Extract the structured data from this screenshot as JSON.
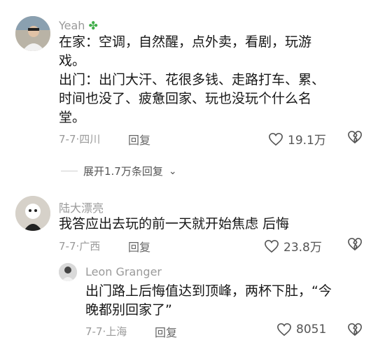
{
  "comments": [
    {
      "username": "Yeah",
      "badge": "four-leaf-clover",
      "content": "在家：空调，自然醒，点外卖，看剧，玩游戏。\n出门：出门大汗、花很多钱、走路打车、累、时间也没了、疲惫回家、玩也没玩个什么名堂。",
      "line1": "在家：空调，自然醒，点外卖，看剧，玩游",
      "line2": "戏。",
      "line3": "出门：出门大汗、花很多钱、走路打车、累、",
      "line4": "时间也没了、疲惫回家、玩也没玩个什么名",
      "line5": "堂。",
      "date": "7-7",
      "location": "四川",
      "reply_label": "回复",
      "likes": "19.1万"
    },
    {
      "username": "陆大漂亮",
      "content": "我答应出去玩的前一天就开始焦虑 后悔",
      "date": "7-7",
      "location": "广西",
      "reply_label": "回复",
      "likes": "23.8万"
    },
    {
      "username": "Leon Granger",
      "line1": "出门路上后悔值达到顶峰，两杯下肚，“今",
      "line2": "晚都别回家了”",
      "date": "7-7",
      "location": "上海",
      "reply_label": "回复",
      "likes": "8051"
    }
  ],
  "expand_replies": "展开1.7万条回复"
}
